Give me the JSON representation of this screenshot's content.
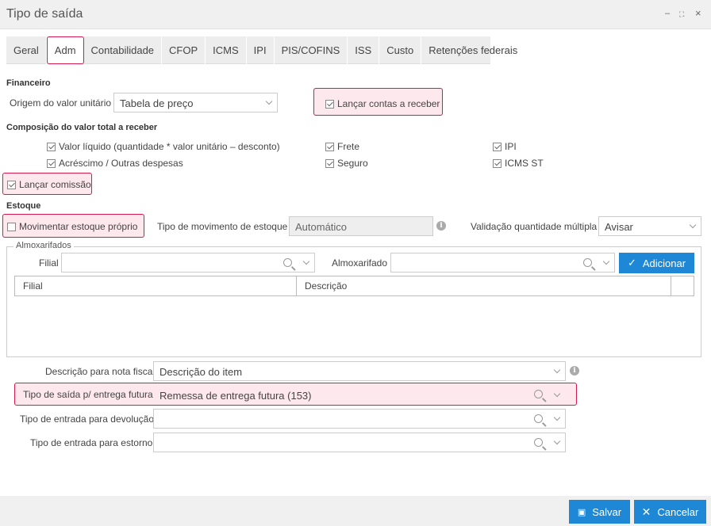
{
  "window": {
    "title": "Tipo de saída",
    "controls": [
      "–",
      "⛶",
      "×"
    ]
  },
  "tabs": [
    "Geral",
    "Adm",
    "Contabilidade",
    "CFOP",
    "ICMS",
    "IPI",
    "PIS/COFINS",
    "ISS",
    "Custo",
    "Retenções federais"
  ],
  "financeiro": {
    "section": "Financeiro",
    "origem_label": "Origem do valor unitário",
    "origem_value": "Tabela de preço",
    "lancar_contas": "Lançar contas a receber"
  },
  "composicao": {
    "section": "Composição do valor total a receber",
    "valor_liquido": "Valor líquido (quantidade * valor unitário – desconto)",
    "acrescimo": "Acréscimo / Outras despesas",
    "frete": "Frete",
    "seguro": "Seguro",
    "ipi": "IPI",
    "icms_st": "ICMS ST"
  },
  "comissao": {
    "label": "Lançar comissão"
  },
  "estoque": {
    "section": "Estoque",
    "movimentar": "Movimentar estoque próprio",
    "tipo_mov_label": "Tipo de movimento de estoque",
    "tipo_mov_value": "Automático",
    "validacao_label": "Validação quantidade múltipla",
    "validacao_value": "Avisar"
  },
  "almoxarifados": {
    "legend": "Almoxarifados",
    "filial_label": "Filial",
    "almox_label": "Almoxarifado",
    "add_button": "Adicionar",
    "columns": [
      "Filial",
      "Descrição"
    ]
  },
  "nota": {
    "desc_label": "Descrição para nota fiscal",
    "desc_value": "Descrição do item",
    "entrega_label": "Tipo de saída p/ entrega futura",
    "entrega_value": "Remessa de entrega futura (153)",
    "devolucao_label": "Tipo de entrada para devolução",
    "estorno_label": "Tipo de entrada para estorno"
  },
  "footer": {
    "save": "Salvar",
    "cancel": "Cancelar"
  }
}
